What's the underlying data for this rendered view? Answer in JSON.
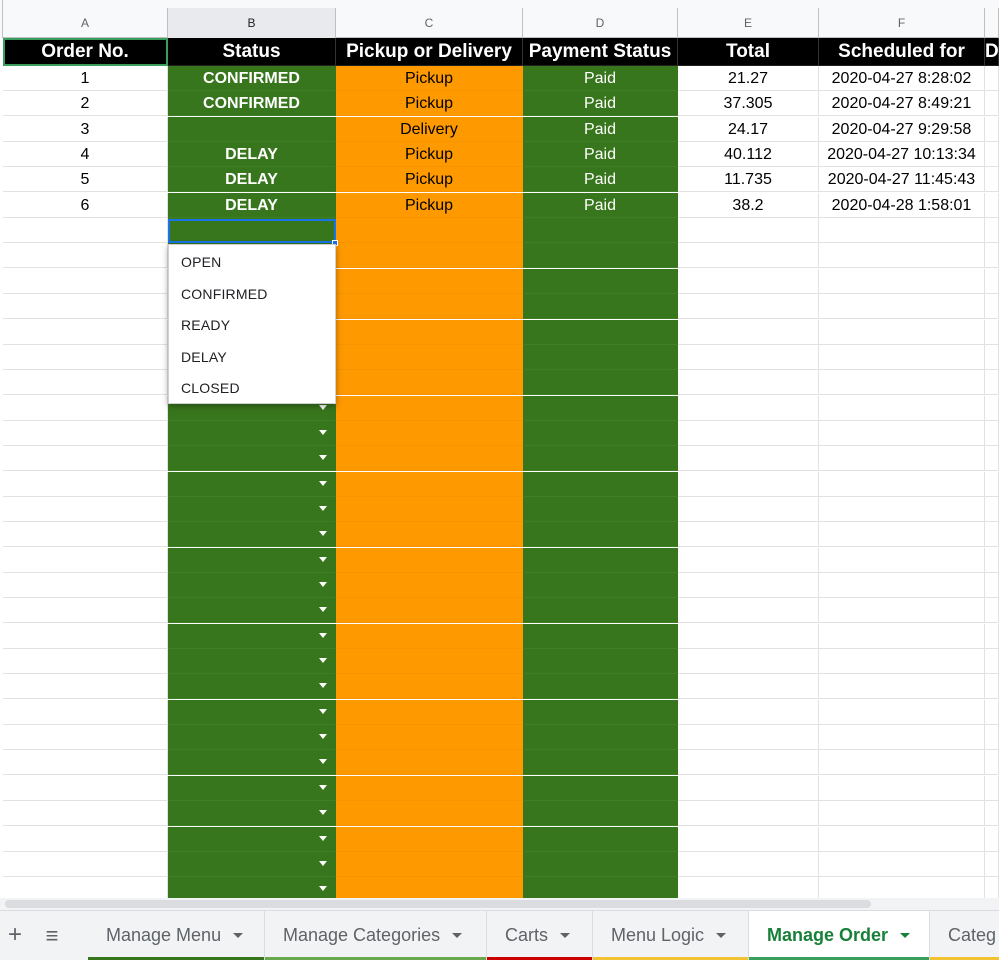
{
  "columns": [
    "A",
    "B",
    "C",
    "D",
    "E",
    "F"
  ],
  "headers": [
    "Order No.",
    "Status",
    "Pickup or Delivery",
    "Payment Status",
    "Total",
    "Scheduled for",
    "D"
  ],
  "rows": [
    {
      "order": "1",
      "status": "CONFIRMED",
      "mode": "Pickup",
      "payment": "Paid",
      "total": "21.27",
      "scheduled": "2020-04-27 8:28:02"
    },
    {
      "order": "2",
      "status": "CONFIRMED",
      "mode": "Pickup",
      "payment": "Paid",
      "total": "37.305",
      "scheduled": "2020-04-27 8:49:21"
    },
    {
      "order": "3",
      "status": "",
      "mode": "Delivery",
      "payment": "Paid",
      "total": "24.17",
      "scheduled": "2020-04-27 9:29:58"
    },
    {
      "order": "4",
      "status": "DELAY",
      "mode": "Pickup",
      "payment": "Paid",
      "total": "40.112",
      "scheduled": "2020-04-27 10:13:34"
    },
    {
      "order": "5",
      "status": "DELAY",
      "mode": "Pickup",
      "payment": "Paid",
      "total": "11.735",
      "scheduled": "2020-04-27 11:45:43"
    },
    {
      "order": "6",
      "status": "DELAY",
      "mode": "Pickup",
      "payment": "Paid",
      "total": "38.2",
      "scheduled": "2020-04-28 1:58:01"
    }
  ],
  "dropdown": {
    "options": [
      "OPEN",
      "CONFIRMED",
      "READY",
      "DELAY",
      "CLOSED"
    ]
  },
  "tabs": [
    {
      "label": "Manage Menu",
      "color": "#38761d",
      "active": false
    },
    {
      "label": "Manage Categories",
      "color": "#6aa84f",
      "active": false
    },
    {
      "label": "Carts",
      "color": "#cc0000",
      "active": false
    },
    {
      "label": "Menu Logic",
      "color": "#f1c232",
      "active": false
    },
    {
      "label": "Manage Order",
      "color": "#38a05a",
      "active": true
    },
    {
      "label": "Categ",
      "color": "#f1c232",
      "active": false
    }
  ],
  "colors": {
    "status_green": "#38761d",
    "pickup_orange": "#ff9900",
    "selection_blue": "#1a73e8",
    "active_tab": "#188038"
  },
  "icons": [
    "add-sheet-icon",
    "all-sheets-icon",
    "dropdown-arrow-icon"
  ]
}
